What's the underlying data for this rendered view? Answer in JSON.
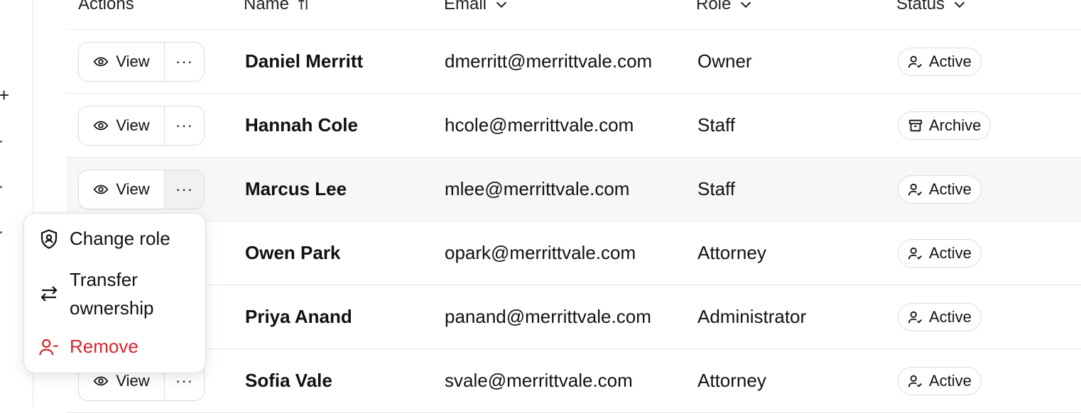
{
  "table": {
    "columns": [
      {
        "label": "Actions"
      },
      {
        "label": "Name",
        "sort": "ascending"
      },
      {
        "label": "Email"
      },
      {
        "label": "Role"
      },
      {
        "label": "Status"
      }
    ],
    "view_label": "View",
    "more_label": "···",
    "rows": [
      {
        "name": "Daniel Merritt",
        "email": "dmerritt@merrittvale.com",
        "role": "Owner",
        "status": "Active",
        "status_icon": "user-check-icon"
      },
      {
        "name": "Hannah Cole",
        "email": "hcole@merrittvale.com",
        "role": "Staff",
        "status": "Archive",
        "status_icon": "archive-icon"
      },
      {
        "name": "Marcus Lee",
        "email": "mlee@merrittvale.com",
        "role": "Staff",
        "status": "Active",
        "status_icon": "user-check-icon"
      },
      {
        "name": "Owen Park",
        "email": "opark@merrittvale.com",
        "role": "Attorney",
        "status": "Active",
        "status_icon": "user-check-icon"
      },
      {
        "name": "Priya Anand",
        "email": "panand@merrittvale.com",
        "role": "Administrator",
        "status": "Active",
        "status_icon": "user-check-icon"
      },
      {
        "name": "Sofia Vale",
        "email": "svale@merrittvale.com",
        "role": "Attorney",
        "status": "Active",
        "status_icon": "user-check-icon"
      }
    ]
  },
  "menu": {
    "change_role": "Change role",
    "transfer_line1": "Transfer",
    "transfer_line2": "ownership",
    "remove": "Remove"
  },
  "colors": {
    "danger": "#d6262b",
    "border": "#dcdcdc",
    "hover_row": "#f7f7f7"
  }
}
